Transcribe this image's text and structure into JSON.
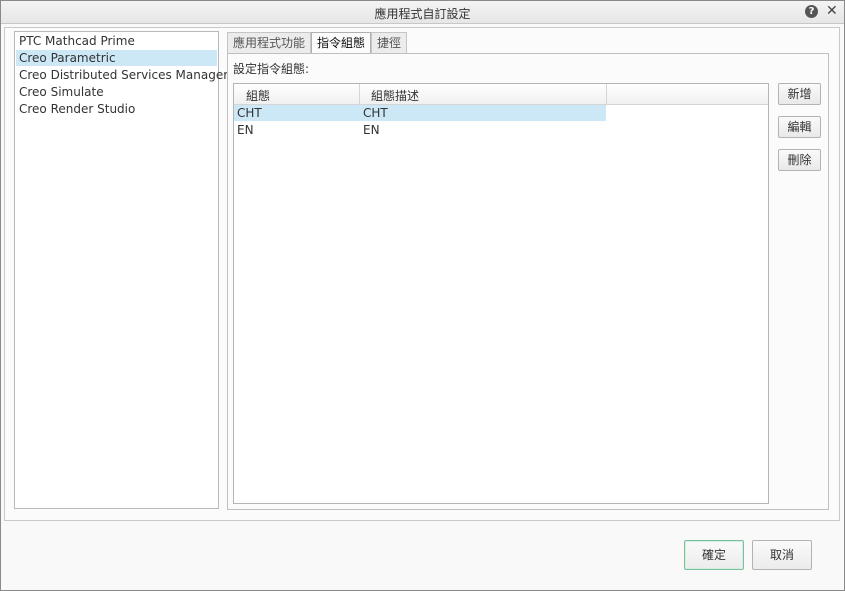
{
  "window": {
    "title": "應用程式自訂設定"
  },
  "app_list": {
    "items": [
      {
        "label": "PTC Mathcad Prime",
        "selected": false
      },
      {
        "label": "Creo Parametric",
        "selected": true
      },
      {
        "label": "Creo Distributed Services Manager",
        "selected": false
      },
      {
        "label": "Creo Simulate",
        "selected": false
      },
      {
        "label": "Creo Render Studio",
        "selected": false
      }
    ]
  },
  "tabs": [
    {
      "label": "應用程式功能",
      "active": false
    },
    {
      "label": "指令組態",
      "active": true
    },
    {
      "label": "捷徑",
      "active": false
    }
  ],
  "panel": {
    "label": "設定指令組態:",
    "columns": [
      "組態",
      "組態描述"
    ],
    "rows": [
      {
        "config": "CHT",
        "description": "CHT",
        "selected": true
      },
      {
        "config": "EN",
        "description": "EN",
        "selected": false
      }
    ],
    "buttons": {
      "add": "新增",
      "edit": "編輯",
      "delete": "刪除"
    }
  },
  "footer": {
    "ok": "確定",
    "cancel": "取消"
  },
  "colors": {
    "selection": "#cce8f6",
    "default_button_border": "#7cbf9c"
  }
}
